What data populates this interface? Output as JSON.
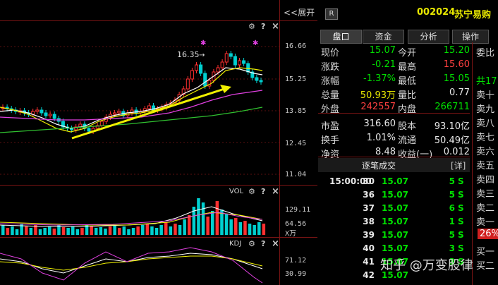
{
  "chart_header": {
    "expand_label": "<<展开"
  },
  "toolbar_icons": {
    "gear": "gear-icon",
    "help": "?",
    "close": "×"
  },
  "price_axis": [
    "16.66",
    "15.25",
    "13.85",
    "12.45",
    "11.04"
  ],
  "annotation": {
    "high_marker": "16.35"
  },
  "vol_panel": {
    "label": "VOL",
    "axis": [
      "129.11",
      "64.56"
    ],
    "unit": "X万"
  },
  "kdj_panel": {
    "label": "KDJ",
    "axis": [
      "71.12",
      "30.99"
    ]
  },
  "stock": {
    "badge": "R",
    "code": "002024",
    "name": "苏宁易购"
  },
  "tabs": [
    "盘口",
    "资金",
    "分析",
    "操作"
  ],
  "quote_rows": [
    {
      "l1": "现价",
      "v1": "15.07",
      "c1": "green",
      "l2": "今开",
      "v2": "15.20",
      "c2": "green"
    },
    {
      "l1": "涨跌",
      "v1": "-0.21",
      "c1": "green",
      "l2": "最高",
      "v2": "15.60",
      "c2": "red"
    },
    {
      "l1": "涨幅",
      "v1": "-1.37%",
      "c1": "green",
      "l2": "最低",
      "v2": "15.05",
      "c2": "green"
    },
    {
      "l1": "总量",
      "v1": "50.93万",
      "c1": "yellow",
      "l2": "量比",
      "v2": "0.77",
      "c2": "white"
    },
    {
      "l1": "外盘",
      "v1": "242557",
      "c1": "red",
      "l2": "内盘",
      "v2": "266711",
      "c2": "green"
    },
    {
      "l1": "市盈",
      "v1": "316.60",
      "c1": "white",
      "l2": "股本",
      "v2": "93.10亿",
      "c2": "white"
    },
    {
      "l1": "换手",
      "v1": "1.01%",
      "c1": "white",
      "l2": "流通",
      "v2": "50.49亿",
      "c2": "white"
    },
    {
      "l1": "净资",
      "v1": "8.48",
      "c1": "white",
      "l2": "收益(一)",
      "v2": "0.012",
      "c2": "white"
    }
  ],
  "side_labels": [
    "委比",
    "共17",
    "卖十",
    "卖九",
    "卖八",
    "卖七",
    "卖六",
    "卖五",
    "卖四",
    "卖三",
    "卖二",
    "卖一",
    "26%",
    "买一",
    "买二"
  ],
  "ticks_header": {
    "title": "逐笔成交",
    "detail": "[详]"
  },
  "ticks": [
    {
      "time": "15:00:00",
      "qty": "30",
      "price": "15.07",
      "vol": "5",
      "side": "S"
    },
    {
      "time": "",
      "qty": "36",
      "price": "15.07",
      "vol": "5",
      "side": "S"
    },
    {
      "time": "",
      "qty": "37",
      "price": "15.07",
      "vol": "6",
      "side": "S"
    },
    {
      "time": "",
      "qty": "38",
      "price": "15.07",
      "vol": "1",
      "side": "S"
    },
    {
      "time": "",
      "qty": "39",
      "price": "15.07",
      "vol": "5",
      "side": "S"
    },
    {
      "time": "",
      "qty": "40",
      "price": "15.07",
      "vol": "3",
      "side": "S"
    },
    {
      "time": "",
      "qty": "41",
      "price": "15.07",
      "vol": "3",
      "side": "S"
    },
    {
      "time": "",
      "qty": "42",
      "price": "15.07",
      "vol": "",
      "side": ""
    }
  ],
  "watermark": "知乎 @万变股律",
  "colors": {
    "up": "#ff3030",
    "down": "#00d0d0",
    "accent_yellow": "#f0f000",
    "grid": "#7a1414"
  }
}
